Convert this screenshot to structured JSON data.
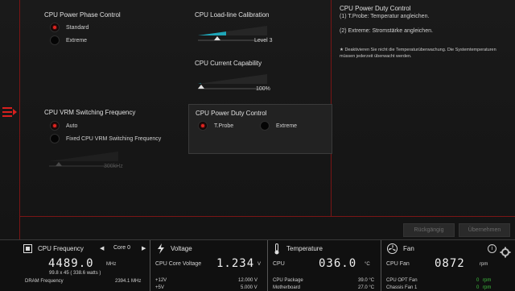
{
  "phase": {
    "title": "CPU Power Phase Control",
    "options": [
      "Standard",
      "Extreme"
    ]
  },
  "loadline": {
    "title": "CPU Load-line Calibration",
    "value": "Level 3",
    "level": 0.4
  },
  "current": {
    "title": "CPU Current Capability",
    "value": "100%",
    "level": 0.05
  },
  "vrm": {
    "title": "CPU VRM Switching Frequency",
    "options": [
      "Auto",
      "Fixed CPU VRM Switching Frequency"
    ],
    "slider_value": "300kHz"
  },
  "duty": {
    "title": "CPU Power Duty Control",
    "options": [
      "T.Probe",
      "Extreme"
    ]
  },
  "help": {
    "title": "CPU Power Duty Control",
    "line1": "(1) T.Probe: Temperatur angleichen.",
    "line2": "(2) Extreme: Stromstärke angleichen.",
    "note": "★ Deaktivieren Sie nicht die Temperaturüberwachung. Die Systemtemperaturen müssen jederzeit überwacht werden."
  },
  "buttons": {
    "back": "Rückgängig",
    "save": "Übernehmen"
  },
  "monitor": {
    "freq": {
      "title": "CPU Frequency",
      "core": "Core 0",
      "value": "4489.0",
      "unit": "MHz",
      "detail": "99.8  x  45    ( 338.6 watts )",
      "dram_label": "DRAM Frequency",
      "dram_value": "2394.1  MHz"
    },
    "voltage": {
      "title": "Voltage",
      "core_label": "CPU Core Voltage",
      "core_value": "1.234",
      "core_unit": "V",
      "v12_label": "+12V",
      "v12_value": "12.000  V",
      "v5_label": "+5V",
      "v5_value": "5.000  V"
    },
    "temp": {
      "title": "Temperature",
      "cpu_label": "CPU",
      "cpu_value": "036.0",
      "cpu_unit": "°C",
      "pkg_label": "CPU Package",
      "pkg_value": "39.0 °C",
      "mb_label": "Motherboard",
      "mb_value": "27.0 °C"
    },
    "fan": {
      "title": "Fan",
      "cpu_label": "CPU Fan",
      "cpu_value": "0872",
      "cpu_unit": "rpm",
      "opt_label": "CPU OPT Fan",
      "opt_value": "0",
      "opt_unit": "rpm",
      "ch1_label": "Chassis Fan 1",
      "ch1_value": "0",
      "ch1_unit": "rpm"
    }
  }
}
